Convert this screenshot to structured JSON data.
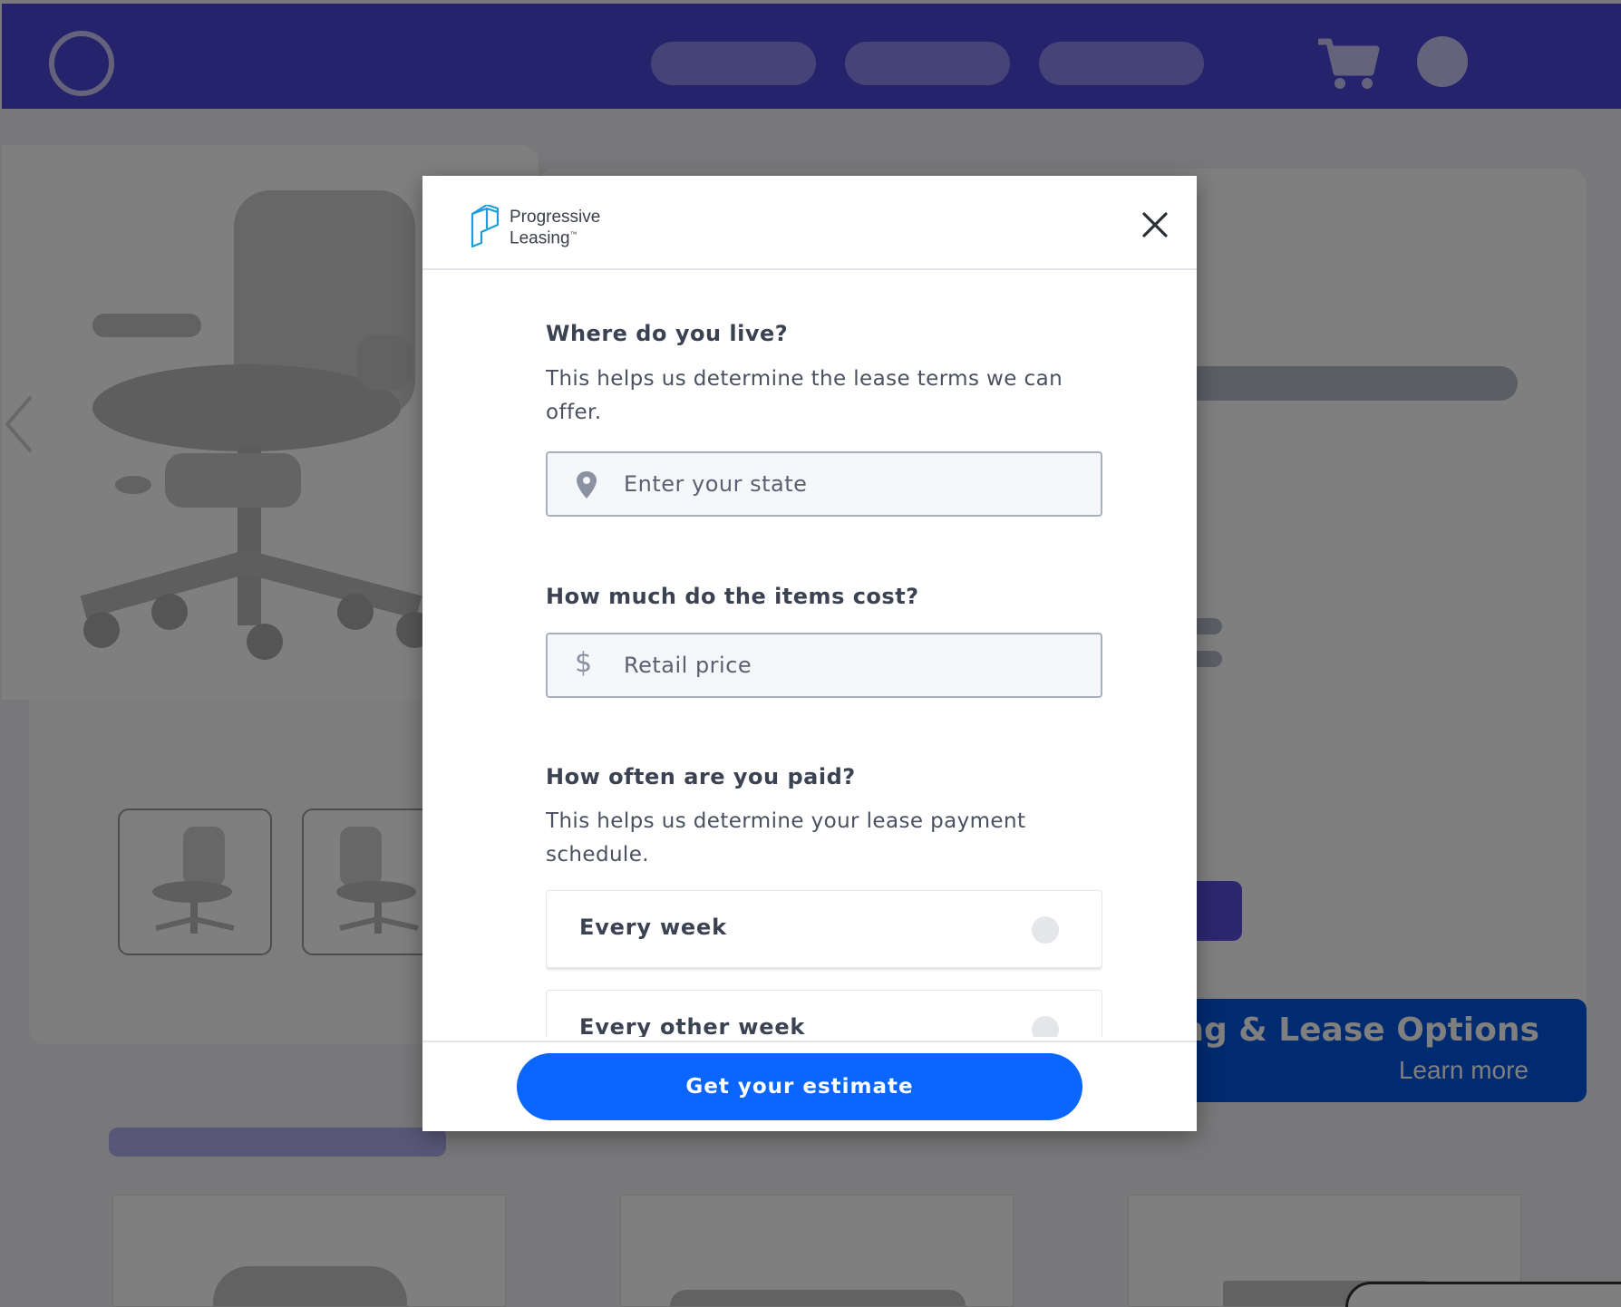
{
  "background": {
    "banner": {
      "title": "ing & Lease Options",
      "link": "Learn more"
    },
    "accent_color": "#4b47d6"
  },
  "modal": {
    "brand": {
      "line1": "Progressive",
      "line2": "Leasing",
      "trademark": "™"
    },
    "close_icon": "close-icon",
    "state_question": {
      "title": "Where do you live?",
      "help": "This helps us determine the lease terms we can offer.",
      "placeholder": "Enter your state",
      "icon": "location-pin-icon"
    },
    "cost_question": {
      "title": "How much do the items cost?",
      "placeholder": "Retail price",
      "icon": "dollar-icon",
      "symbol": "$"
    },
    "pay_question": {
      "title": "How often are you paid?",
      "help": "This helps us determine your lease payment schedule.",
      "options": [
        {
          "label": "Every week",
          "selected": false
        },
        {
          "label": "Every other week",
          "selected": false
        }
      ]
    },
    "cta_label": "Get your estimate",
    "cta_color": "#0a66ff"
  }
}
